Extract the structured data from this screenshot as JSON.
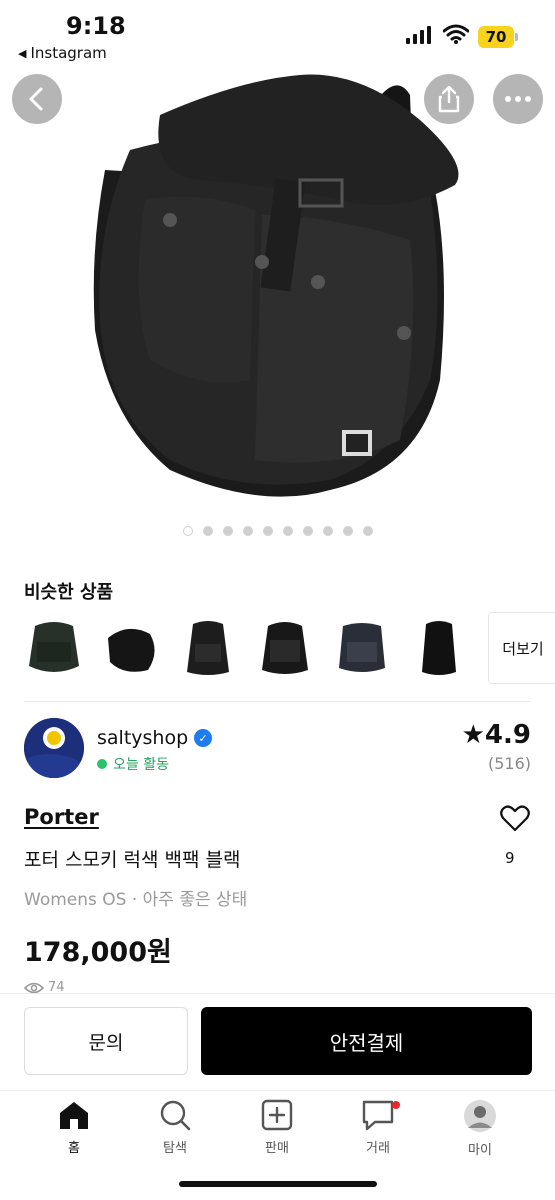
{
  "status_bar": {
    "time": "9:18",
    "back_app": "Instagram",
    "battery": "70"
  },
  "carousel": {
    "total": 10,
    "active_index": 0
  },
  "similar": {
    "title": "비슷한 상품",
    "more_label": "더보기"
  },
  "seller": {
    "name": "saltyshop",
    "activity": "오늘 활동",
    "rating": "★4.9",
    "review_count": "(516)"
  },
  "product": {
    "brand": "Porter",
    "title": "포터 스모키 럭색 백팩 블랙",
    "meta": "Womens OS · 아주 좋은 상태",
    "price": "178,000원",
    "views": "74",
    "likes": "9"
  },
  "actions": {
    "inquiry": "문의",
    "pay": "안전결제"
  },
  "tabs": [
    {
      "label": "홈",
      "icon": "home-icon"
    },
    {
      "label": "탐색",
      "icon": "search-icon"
    },
    {
      "label": "판매",
      "icon": "sell-plus-icon"
    },
    {
      "label": "거래",
      "icon": "chat-icon"
    },
    {
      "label": "마이",
      "icon": "profile-avatar"
    }
  ],
  "colors": {
    "accent": "#000000",
    "verified": "#1e7bf2",
    "online": "#2bc36b",
    "battery": "#f7d31d"
  }
}
